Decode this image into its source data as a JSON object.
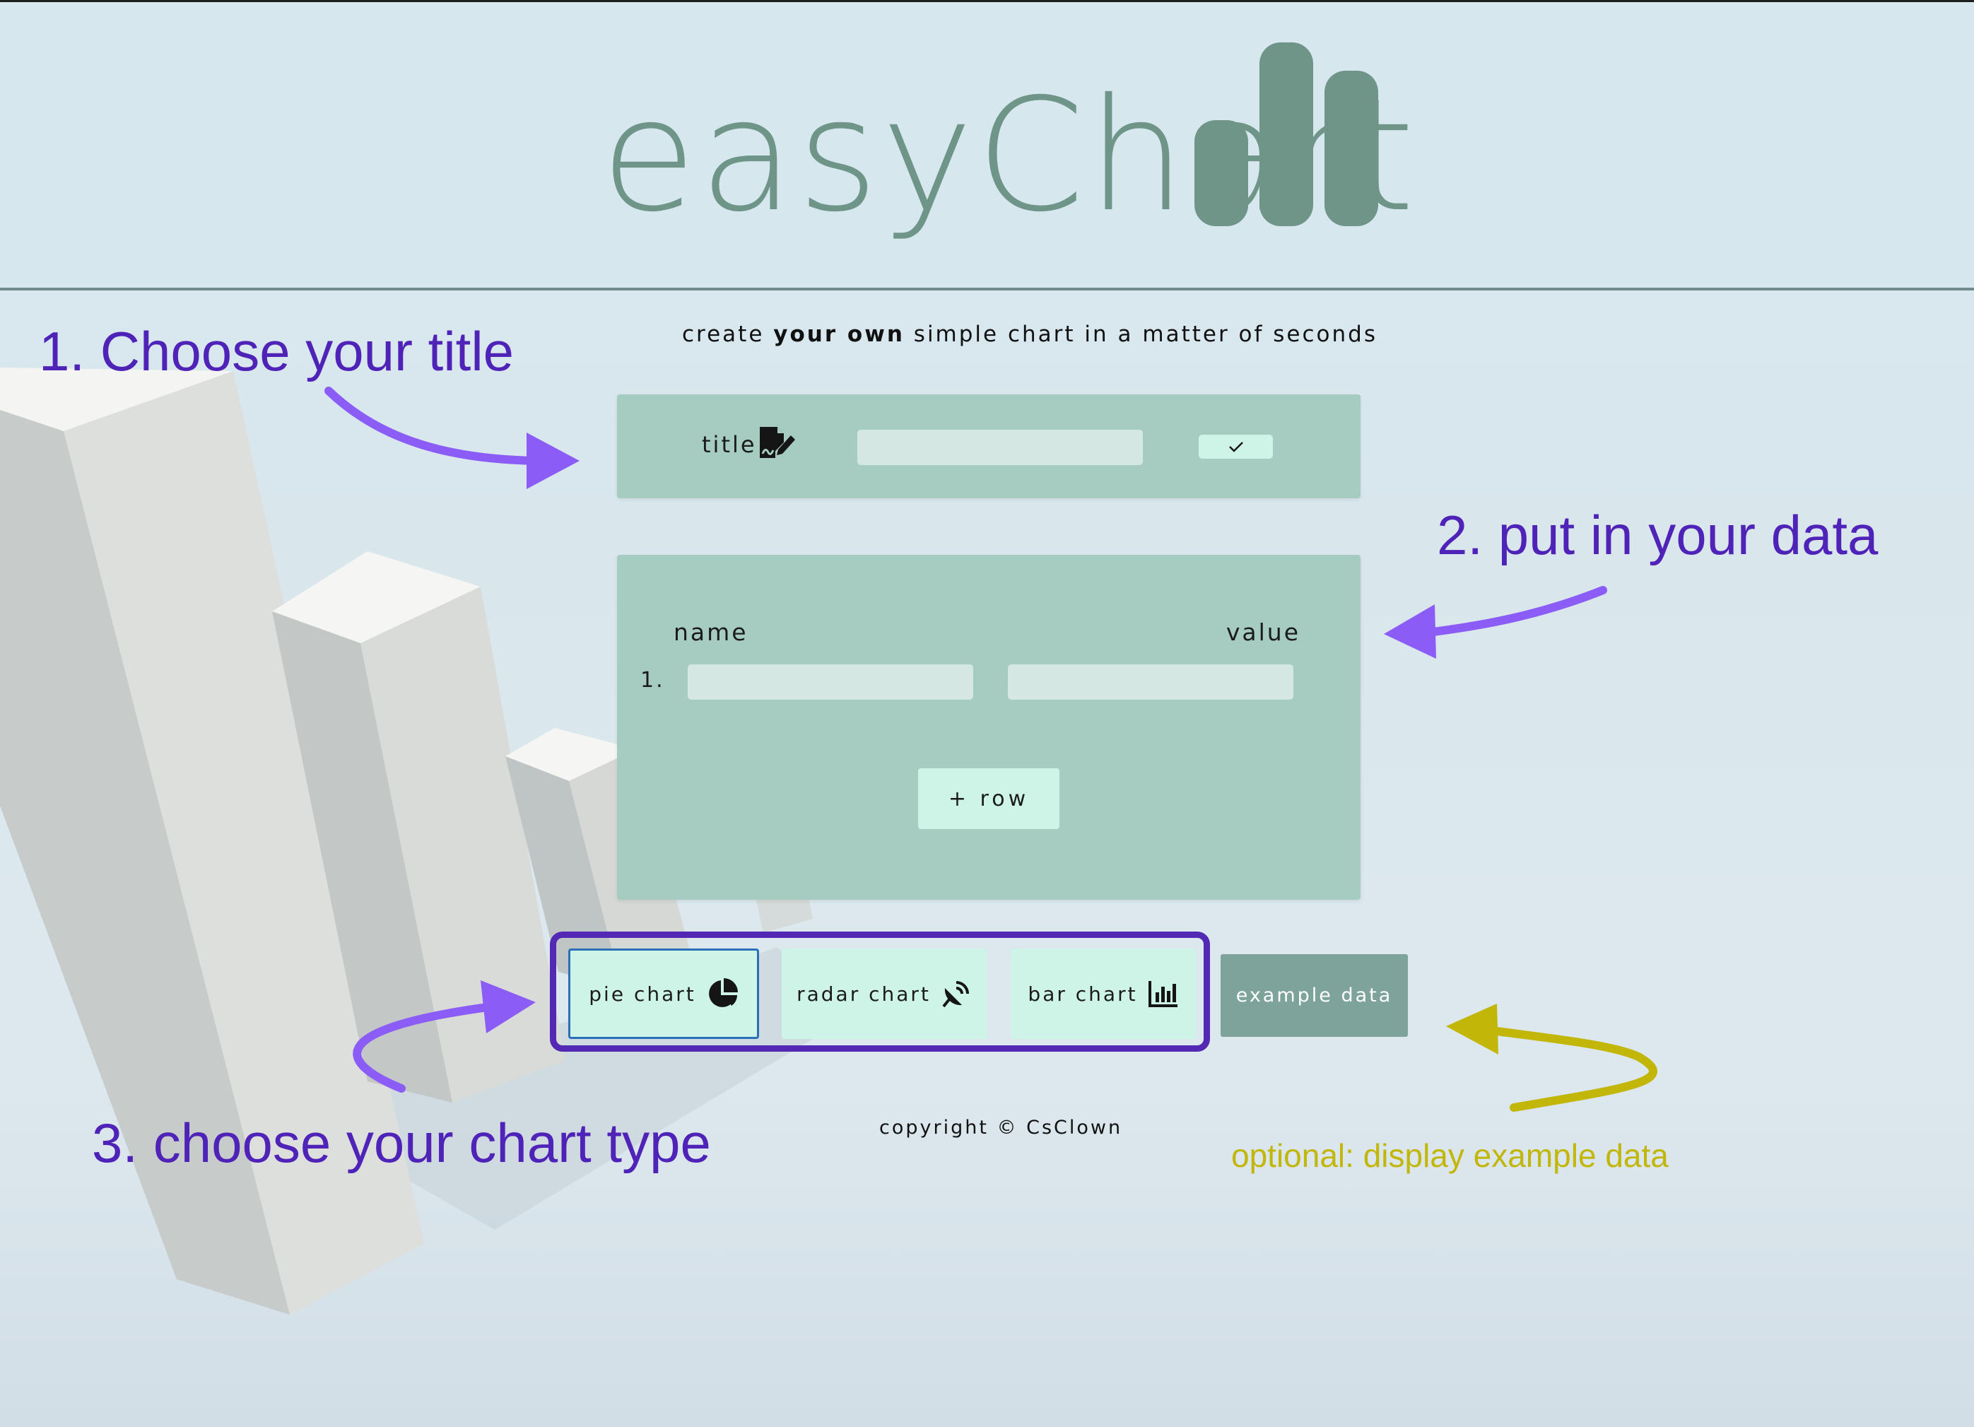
{
  "logo": {
    "text": "easyChart",
    "bars_icon": "bar-chart-logo-icon"
  },
  "colors": {
    "background": "#d7e8ef",
    "panel": "#a6cbc0",
    "input": "#d4e7e2",
    "button": "#cdf4e7",
    "example_button": "#7ea39a",
    "annotation_purple": "#4f22b8",
    "annotation_yellow": "#c2b608",
    "logo": "#6f9589"
  },
  "tagline": {
    "pre": "create ",
    "bold": "your own",
    "post": " simple chart in a matter of seconds"
  },
  "title_panel": {
    "label": "title",
    "icon": "file-signature-icon",
    "input_value": "",
    "confirm_icon": "checkmark-icon"
  },
  "data_panel": {
    "col_name": "name",
    "col_value": "value",
    "rows": [
      {
        "num": "1.",
        "name": "",
        "value": ""
      }
    ],
    "add_row_label": "+ row"
  },
  "chart_types": {
    "pie": {
      "label": "pie chart",
      "icon": "pie-chart-icon",
      "selected": true
    },
    "radar": {
      "label": "radar chart",
      "icon": "satellite-dish-icon"
    },
    "bar": {
      "label": "bar chart",
      "icon": "bar-chart-icon"
    }
  },
  "example_button": {
    "label": "example data"
  },
  "copyright": "copyright © CsClown",
  "annotations": {
    "step1": "1. Choose your title",
    "step2": "2. put in your data",
    "step3": "3. choose your chart type",
    "optional": "optional: display example data"
  }
}
